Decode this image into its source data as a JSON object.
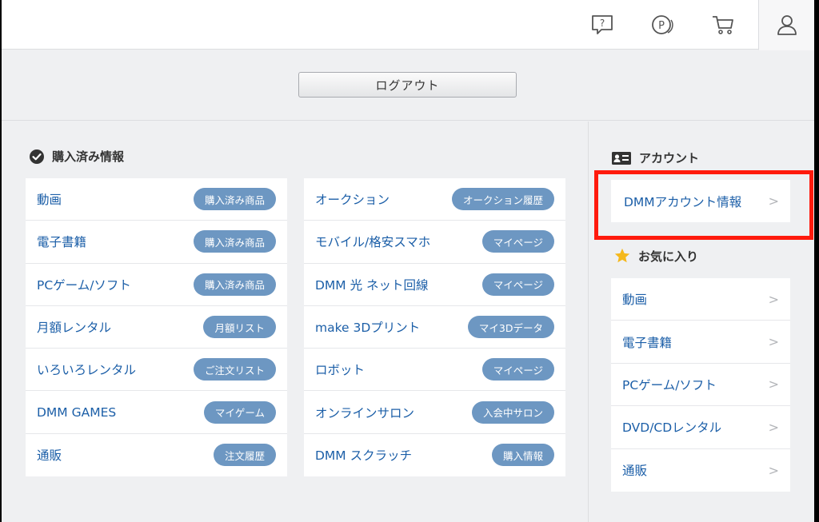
{
  "header": {
    "icons": [
      "help-icon",
      "point-icon",
      "cart-icon",
      "user-icon"
    ]
  },
  "logout": {
    "label": "ログアウト"
  },
  "purchased": {
    "title": "購入済み情報",
    "left": [
      {
        "label": "動画",
        "button": "購入済み商品"
      },
      {
        "label": "電子書籍",
        "button": "購入済み商品"
      },
      {
        "label": "PCゲーム/ソフト",
        "button": "購入済み商品"
      },
      {
        "label": "月額レンタル",
        "button": "月額リスト"
      },
      {
        "label": "いろいろレンタル",
        "button": "ご注文リスト"
      },
      {
        "label": "DMM GAMES",
        "button": "マイゲーム"
      },
      {
        "label": "通販",
        "button": "注文履歴"
      }
    ],
    "right": [
      {
        "label": "オークション",
        "button": "オークション履歴"
      },
      {
        "label": "モバイル/格安スマホ",
        "button": "マイページ"
      },
      {
        "label": "DMM 光 ネット回線",
        "button": "マイページ"
      },
      {
        "label": "make 3Dプリント",
        "button": "マイ3Dデータ"
      },
      {
        "label": "ロボット",
        "button": "マイページ"
      },
      {
        "label": "オンラインサロン",
        "button": "入会中サロン"
      },
      {
        "label": "DMM スクラッチ",
        "button": "購入情報"
      }
    ]
  },
  "account": {
    "title": "アカウント",
    "items": [
      {
        "label": "DMMアカウント情報"
      }
    ]
  },
  "favorites": {
    "title": "お気に入り",
    "items": [
      {
        "label": "動画"
      },
      {
        "label": "電子書籍"
      },
      {
        "label": "PCゲーム/ソフト"
      },
      {
        "label": "DVD/CDレンタル"
      },
      {
        "label": "通販"
      }
    ]
  },
  "chevron": ">",
  "colors": {
    "link": "#1c5fa8",
    "pill": "#6d97c2",
    "highlight": "#ff1a0d"
  }
}
